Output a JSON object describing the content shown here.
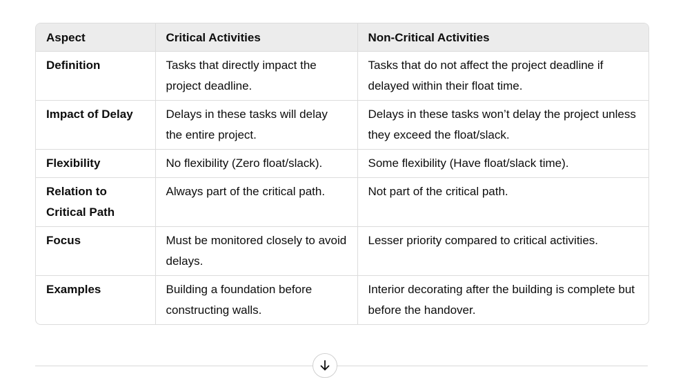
{
  "table": {
    "headers": [
      "Aspect",
      "Critical Activities",
      "Non-Critical Activities"
    ],
    "rows": [
      {
        "aspect": "Definition",
        "critical": "Tasks that directly impact the project deadline.",
        "noncritical": "Tasks that do not affect the project deadline if delayed within their float time."
      },
      {
        "aspect": "Impact of Delay",
        "critical": "Delays in these tasks will delay the entire project.",
        "noncritical": "Delays in these tasks won’t delay the project unless they exceed the float/slack."
      },
      {
        "aspect": "Flexibility",
        "critical": "No flexibility (Zero float/slack).",
        "noncritical": "Some flexibility (Have float/slack time)."
      },
      {
        "aspect": "Relation to Critical Path",
        "critical": "Always part of the critical path.",
        "noncritical": "Not part of the critical path."
      },
      {
        "aspect": "Focus",
        "critical": "Must be monitored closely to avoid delays.",
        "noncritical": "Lesser priority compared to critical activities."
      },
      {
        "aspect": "Examples",
        "critical": "Building a foundation before constructing walls.",
        "noncritical": "Interior decorating after the building is complete but before the handover."
      }
    ]
  },
  "scroll_button": {
    "icon": "arrow-down-icon"
  }
}
